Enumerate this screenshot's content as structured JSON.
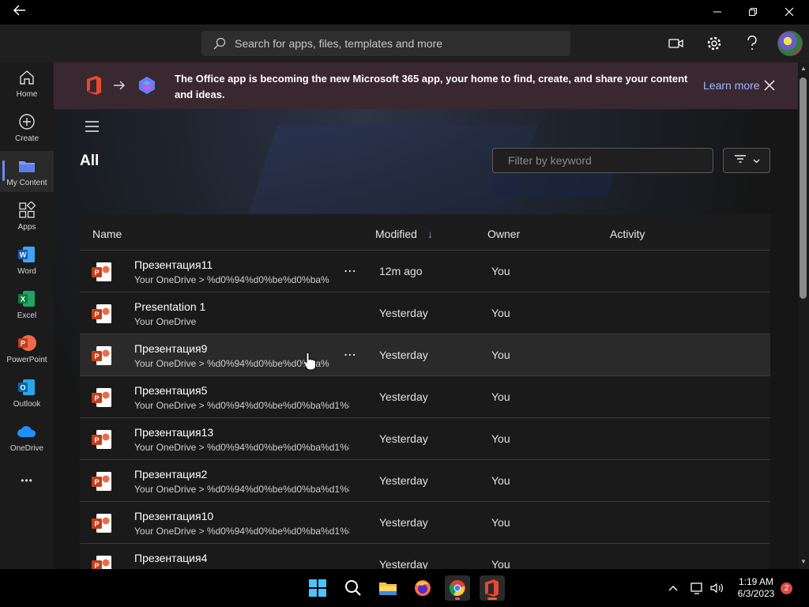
{
  "search": {
    "placeholder": "Search for apps, files, templates and more"
  },
  "rail": {
    "items": [
      {
        "label": "Home"
      },
      {
        "label": "Create"
      },
      {
        "label": "My Content"
      },
      {
        "label": "Apps"
      },
      {
        "label": "Word"
      },
      {
        "label": "Excel"
      },
      {
        "label": "PowerPoint"
      },
      {
        "label": "Outlook"
      },
      {
        "label": "OneDrive"
      }
    ],
    "more": "•••"
  },
  "banner": {
    "message": "The Office app is becoming the new Microsoft 365 app, your home to find, create, and share your content and ideas.",
    "learn_more": "Learn more"
  },
  "page": {
    "title": "All"
  },
  "filter": {
    "placeholder": "Filter by keyword"
  },
  "table": {
    "columns": {
      "name": "Name",
      "modified": "Modified",
      "owner": "Owner",
      "activity": "Activity"
    },
    "sort_indicator": "↓",
    "more_label": "⋯",
    "rows": [
      {
        "name": "Презентация11",
        "path": "Your OneDrive > %d0%94%d0%be%d0%ba%",
        "modified": "12m ago",
        "owner": "You"
      },
      {
        "name": "Presentation 1",
        "path": "Your OneDrive",
        "modified": "Yesterday",
        "owner": "You"
      },
      {
        "name": "Презентация9",
        "path": "Your OneDrive > %d0%94%d0%be%d0%ba%",
        "modified": "Yesterday",
        "owner": "You"
      },
      {
        "name": "Презентация5",
        "path": "Your OneDrive > %d0%94%d0%be%d0%ba%d1%8",
        "modified": "Yesterday",
        "owner": "You"
      },
      {
        "name": "Презентация13",
        "path": "Your OneDrive > %d0%94%d0%be%d0%ba%d1%8",
        "modified": "Yesterday",
        "owner": "You"
      },
      {
        "name": "Презентация2",
        "path": "Your OneDrive > %d0%94%d0%be%d0%ba%d1%8",
        "modified": "Yesterday",
        "owner": "You"
      },
      {
        "name": "Презентация10",
        "path": "Your OneDrive > %d0%94%d0%be%d0%ba%d1%8",
        "modified": "Yesterday",
        "owner": "You"
      },
      {
        "name": "Презентация4",
        "path": "",
        "modified": "Yesterday",
        "owner": "You"
      }
    ]
  },
  "taskbar": {
    "time": "1:19 AM",
    "date": "6/3/2023",
    "notifications": "2"
  },
  "colors": {
    "accent": "#6b8df2",
    "link": "#9fb6ff",
    "banner_bg": "#3a2830",
    "powerpoint": "#c43e1c"
  }
}
